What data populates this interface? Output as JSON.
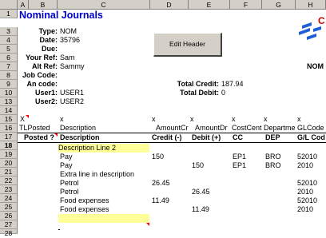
{
  "columns": [
    "A",
    "B",
    "C",
    "D",
    "E",
    "F",
    "G",
    "H"
  ],
  "rows": [
    "1",
    "3",
    "4",
    "5",
    "6",
    "7",
    "8",
    "9",
    "10",
    "13",
    "14",
    "15",
    "16",
    "17",
    "18",
    "19",
    "20",
    "21",
    "22",
    "23",
    "24",
    "25",
    "26",
    "27",
    "28"
  ],
  "title": "Nominal Journals",
  "button": {
    "edit_header": "Edit Header"
  },
  "fields": [
    {
      "label": "Type:",
      "value": "NOM"
    },
    {
      "label": "Date:",
      "value": "35796"
    },
    {
      "label": "Due:",
      "value": ""
    },
    {
      "label": "Your Ref:",
      "value": "Sam"
    },
    {
      "label": "Alt Ref:",
      "value": "Sammy"
    },
    {
      "label": "Job Code:",
      "value": ""
    },
    {
      "label": "An code:",
      "value": ""
    },
    {
      "label": "User1:",
      "value": "USER1"
    },
    {
      "label": "User2:",
      "value": "USER2"
    }
  ],
  "right_label": "NOM",
  "logo_text": "C",
  "totals": {
    "credit_label": "Total Credit:",
    "credit_value": "187.94",
    "debit_label": "Total Debit:",
    "debit_value": "0"
  },
  "row17": [
    "X",
    "x",
    "x",
    "x",
    "x",
    "x",
    "x"
  ],
  "row18": [
    "TLPosted",
    "Description",
    "AmountCr",
    "AmountDr",
    "CostCent",
    "Departme",
    "GLCode"
  ],
  "row19": [
    "Posted ?",
    "Description",
    "Credit (-)",
    "Debit (+)",
    "CC",
    "DEP",
    "G/L Cod"
  ],
  "lines": [
    {
      "desc": "Description Line 2",
      "credit": "",
      "debit": "",
      "cc": "",
      "dep": "",
      "gl": "",
      "highlight": true
    },
    {
      "desc": "Pay",
      "credit": "150",
      "debit": "",
      "cc": "EP1",
      "dep": "BRO",
      "gl": "52010"
    },
    {
      "desc": "Pay",
      "credit": "",
      "debit": "150",
      "cc": "EP1",
      "dep": "BRO",
      "gl": "2010"
    },
    {
      "desc": "Extra line in description",
      "credit": "",
      "debit": "",
      "cc": "",
      "dep": "",
      "gl": ""
    },
    {
      "desc": "Petrol",
      "credit": "26.45",
      "debit": "",
      "cc": "",
      "dep": "",
      "gl": "52010"
    },
    {
      "desc": "Petrol",
      "credit": "",
      "debit": "26.45",
      "cc": "",
      "dep": "",
      "gl": "2010"
    },
    {
      "desc": "Food expenses",
      "credit": "11.49",
      "debit": "",
      "cc": "",
      "dep": "",
      "gl": "52010"
    },
    {
      "desc": "Food expenses",
      "credit": "",
      "debit": "11.49",
      "cc": "",
      "dep": "",
      "gl": "2010"
    },
    {
      "desc": "",
      "credit": "",
      "debit": "",
      "cc": "",
      "dep": "",
      "gl": "",
      "highlight": true
    }
  ]
}
